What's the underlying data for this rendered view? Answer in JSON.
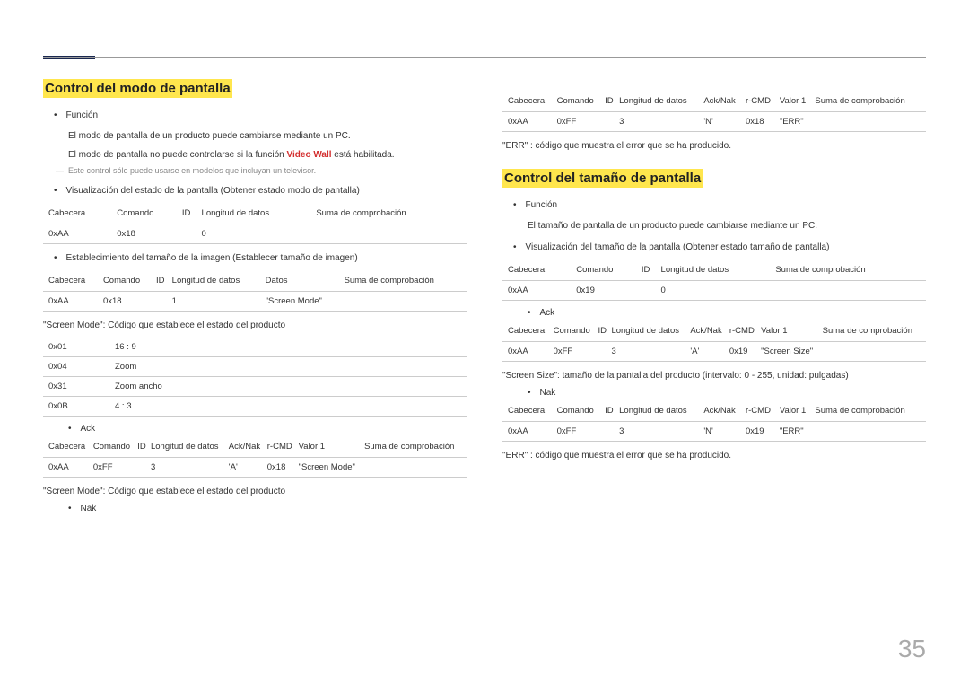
{
  "pageNumber": "35",
  "left": {
    "title": "Control del modo de pantalla",
    "funcLabel": "Función",
    "funcLine1": "El modo de pantalla de un producto puede cambiarse mediante un PC.",
    "funcLine2a": "El modo de pantalla no puede controlarse si la función ",
    "funcLine2b": "Video Wall",
    "funcLine2c": " está habilitada.",
    "note": "Este control sólo puede usarse en modelos que incluyan un televisor.",
    "viewState": "Visualización del estado de la pantalla (Obtener estado modo de pantalla)",
    "t1h": [
      "Cabecera",
      "Comando",
      "ID",
      "Longitud de datos",
      "Suma de comprobación"
    ],
    "t1r": [
      "0xAA",
      "0x18",
      "",
      "0",
      ""
    ],
    "setSize": "Establecimiento del tamaño de la imagen (Establecer tamaño de imagen)",
    "t2h": [
      "Cabecera",
      "Comando",
      "ID",
      "Longitud de datos",
      "Datos",
      "Suma de comprobación"
    ],
    "t2r": [
      "0xAA",
      "0x18",
      "",
      "1",
      "\"Screen Mode\"",
      ""
    ],
    "screenModeDesc": "\"Screen Mode\": Código que establece el estado del producto",
    "t3": [
      [
        "0x01",
        "16 : 9"
      ],
      [
        "0x04",
        "Zoom"
      ],
      [
        "0x31",
        "Zoom ancho"
      ],
      [
        "0x0B",
        "4 : 3"
      ]
    ],
    "ack": "Ack",
    "t4h": [
      "Cabecera",
      "Comando",
      "ID",
      "Longitud de datos",
      "Ack/Nak",
      "r-CMD",
      "Valor 1",
      "Suma de comprobación"
    ],
    "t4r": [
      "0xAA",
      "0xFF",
      "",
      "3",
      "'A'",
      "0x18",
      "\"Screen Mode\"",
      ""
    ],
    "screenModeDesc2": "\"Screen Mode\": Código que establece el estado del producto",
    "nak": "Nak"
  },
  "right": {
    "t5h": [
      "Cabecera",
      "Comando",
      "ID",
      "Longitud de datos",
      "Ack/Nak",
      "r-CMD",
      "Valor 1",
      "Suma de comprobación"
    ],
    "t5r": [
      "0xAA",
      "0xFF",
      "",
      "3",
      "'N'",
      "0x18",
      "\"ERR\"",
      ""
    ],
    "errDesc": "\"ERR\" : código que muestra el error que se ha producido.",
    "title": "Control del tamaño de pantalla",
    "funcLabel": "Función",
    "funcLine1": "El tamaño de pantalla de un producto puede cambiarse mediante un PC.",
    "viewState": "Visualización del tamaño de la pantalla (Obtener estado tamaño de pantalla)",
    "t6h": [
      "Cabecera",
      "Comando",
      "ID",
      "Longitud de datos",
      "Suma de comprobación"
    ],
    "t6r": [
      "0xAA",
      "0x19",
      "",
      "0",
      ""
    ],
    "ack": "Ack",
    "t7h": [
      "Cabecera",
      "Comando",
      "ID",
      "Longitud de datos",
      "Ack/Nak",
      "r-CMD",
      "Valor 1",
      "Suma de comprobación"
    ],
    "t7r": [
      "0xAA",
      "0xFF",
      "",
      "3",
      "'A'",
      "0x19",
      "\"Screen Size\"",
      ""
    ],
    "screenSizeDesc": "\"Screen Size\": tamaño de la pantalla del producto (intervalo: 0 - 255, unidad: pulgadas)",
    "nak": "Nak",
    "t8h": [
      "Cabecera",
      "Comando",
      "ID",
      "Longitud de datos",
      "Ack/Nak",
      "r-CMD",
      "Valor 1",
      "Suma de comprobación"
    ],
    "t8r": [
      "0xAA",
      "0xFF",
      "",
      "3",
      "'N'",
      "0x19",
      "\"ERR\"",
      ""
    ],
    "errDesc2": "\"ERR\" : código que muestra el error que se ha producido."
  }
}
